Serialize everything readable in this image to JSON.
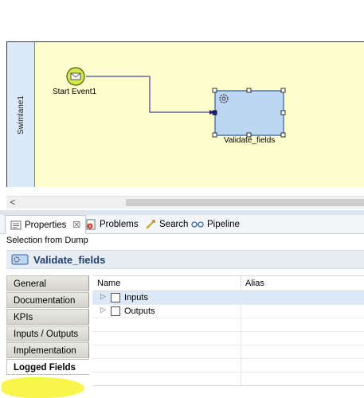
{
  "diagram": {
    "lane_label": "Swimlane1",
    "start_event_label": "Start Event1",
    "task_label": "Validate_fields",
    "colors": {
      "pool_bg": "#fffecd",
      "lane_strip": "#dce9f8",
      "start_fill": "#d5ea4a",
      "task_fill": "#bdd6f2",
      "connector": "#1a1a8c"
    }
  },
  "scrollbar": {
    "left_arrow": "<"
  },
  "properties": {
    "tabs": [
      {
        "label": "Properties",
        "icon": "properties-icon",
        "active": true
      },
      {
        "label": "Problems",
        "icon": "problems-icon"
      },
      {
        "label": "Search",
        "icon": "search-icon"
      },
      {
        "label": "Pipeline",
        "icon": "pipeline-icon"
      }
    ],
    "close_glyph": "☒",
    "selection_text": "Selection from Dump",
    "header_title": "Validate_fields",
    "side_tabs": [
      "General",
      "Documentation",
      "KPIs",
      "Inputs / Outputs",
      "Implementation",
      "Logged Fields"
    ],
    "active_side_tab": "Logged Fields",
    "table": {
      "columns": [
        "Name",
        "Alias"
      ],
      "rows": [
        {
          "name": "Inputs",
          "selected": true
        },
        {
          "name": "Outputs",
          "selected": false
        }
      ]
    }
  }
}
